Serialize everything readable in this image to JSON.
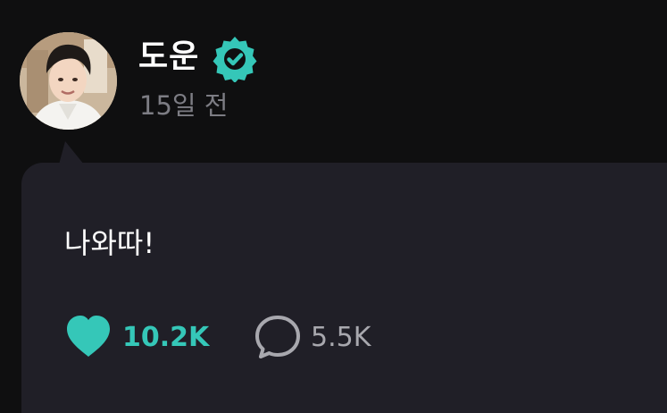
{
  "post": {
    "author": {
      "name": "도운",
      "verified": true,
      "avatar_icon": "profile-photo-icon"
    },
    "timestamp": "15일 전",
    "message": "나와따!",
    "stats": {
      "likes": "10.2K",
      "comments": "5.5K"
    }
  },
  "colors": {
    "background": "#0f0f10",
    "bubble": "#201f27",
    "accent": "#35c7b8",
    "muted": "#7d7d84",
    "comment_text": "#a8a8ae"
  },
  "icons": {
    "verified": "verified-badge-icon",
    "like": "heart-icon",
    "comment": "comment-bubble-icon"
  }
}
